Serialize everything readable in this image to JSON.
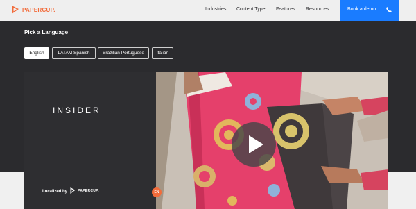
{
  "brand": {
    "name": "PAPERCUP.",
    "accent": "#f26b3a",
    "cta_color": "#1a7cff"
  },
  "nav": {
    "links": [
      "Industries",
      "Content Type",
      "Features",
      "Resources"
    ],
    "cta_label": "Book a demo",
    "cta_icon": "phone-icon"
  },
  "language_picker": {
    "title": "Pick a Language",
    "options": [
      "English",
      "LATAM Spanish",
      "Brazilian Portuguese",
      "Italian"
    ],
    "selected": "English"
  },
  "video": {
    "channel_title": "INSIDER",
    "localized_label": "Localized by",
    "localized_brand": "PAPERCUP.",
    "language_badge": "EN",
    "play_icon": "play-icon"
  }
}
